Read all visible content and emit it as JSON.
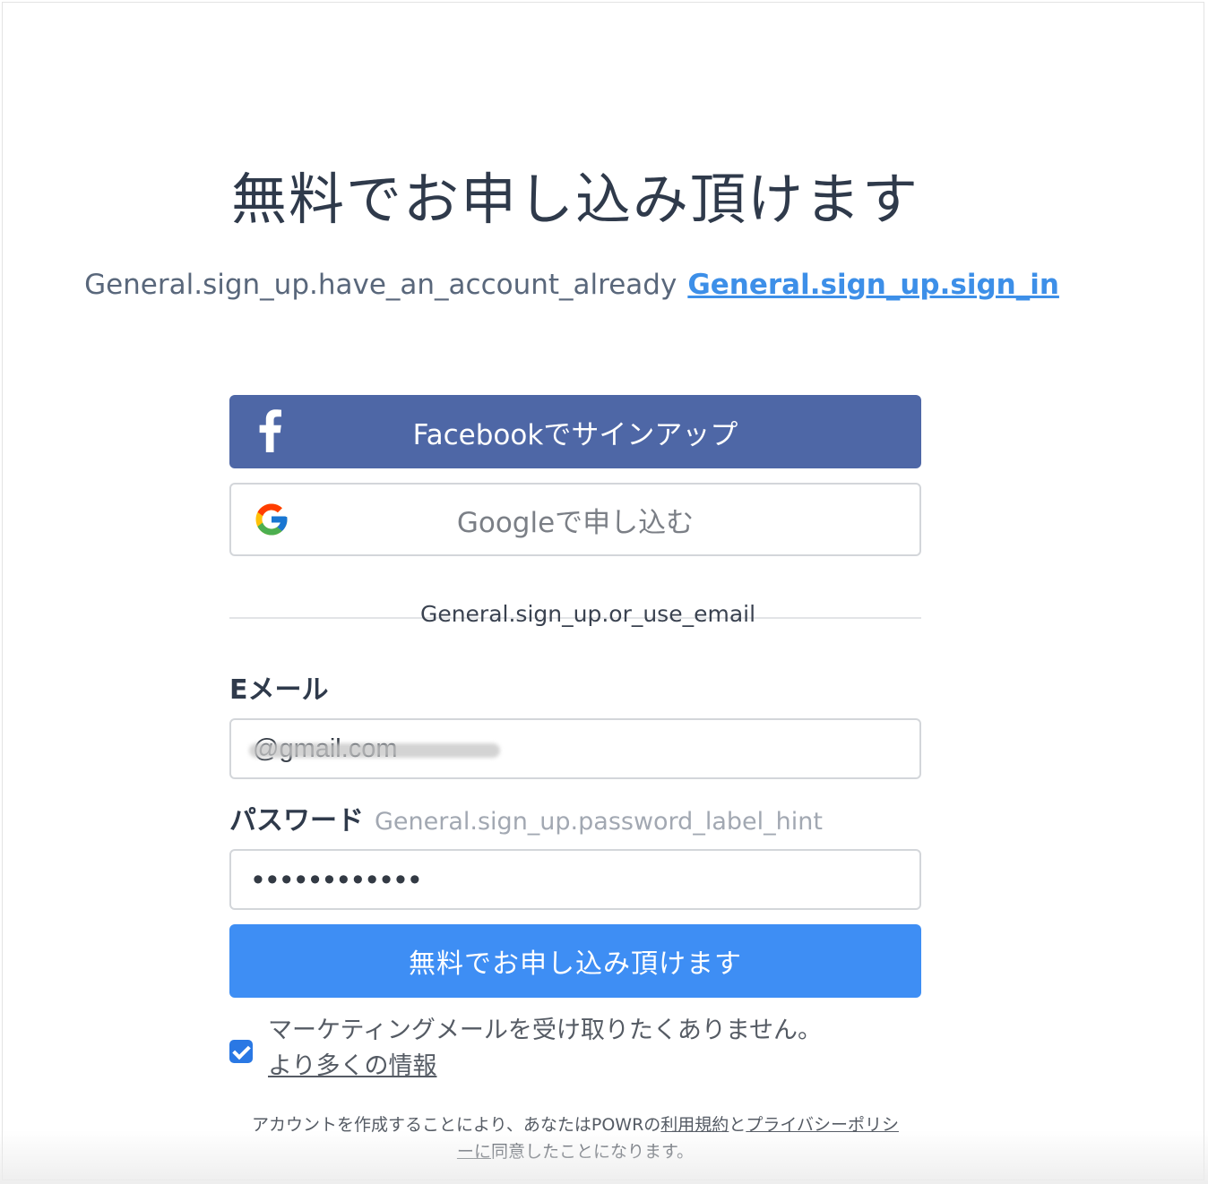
{
  "title": "無料でお申し込み頂けます",
  "signin": {
    "prompt": "General.sign_up.have_an_account_already",
    "link": "General.sign_up.sign_in"
  },
  "social": {
    "facebook_label": "Facebookでサインアップ",
    "google_label": "Googleで申し込む"
  },
  "divider_text": "General.sign_up.or_use_email",
  "email": {
    "label": "Eメール",
    "value": "@gmail.com"
  },
  "password": {
    "label": "パスワード",
    "hint": "General.sign_up.password_label_hint",
    "value": "••••••••••••"
  },
  "submit_label": "無料でお申し込み頂けます",
  "marketing": {
    "checked": true,
    "text": "マーケティングメールを受け取りたくありません。",
    "more_link": "より多くの情報"
  },
  "terms": {
    "part1": "アカウントを作成することにより、あなたはPOWRの",
    "tos_link": "利用規約",
    "part2": "と",
    "privacy_link_a": "プライバシーポリシ",
    "privacy_link_b": "ー",
    "privacy_link_c": "に",
    "part3": "同意したことになります。"
  },
  "colors": {
    "facebook": "#4e67a6",
    "primary": "#3e8ef4",
    "link": "#3d8fe8"
  }
}
